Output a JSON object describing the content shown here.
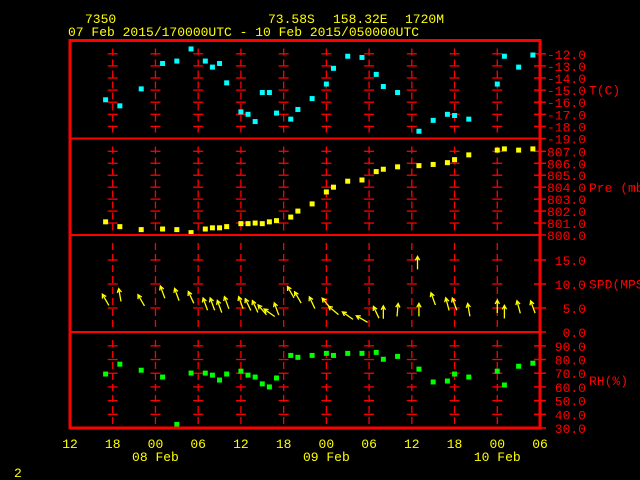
{
  "header": {
    "station_id": "7350",
    "latitude": "73.58S",
    "longitude": "158.32E",
    "elevation": "1720M",
    "time_range": "07 Feb 2015/170000UTC - 10 Feb 2015/050000UTC"
  },
  "page_number": "2",
  "colors": {
    "frame": "#ff0000",
    "text": "#ffff00",
    "temperature": "#00ffff",
    "pressure": "#ffff00",
    "wind": "#ffff00",
    "humidity": "#00ff00"
  },
  "chart_data": {
    "type": "scatter",
    "title": "7350  73.58S 158.32E 1720M  07 Feb 2015/170000UTC - 10 Feb 2015/050000UTC",
    "x_units": "hours since 07 Feb 12 UTC",
    "xlim": [
      0,
      66
    ],
    "x_ticks": [
      {
        "h": 0,
        "label": "12"
      },
      {
        "h": 6,
        "label": "18"
      },
      {
        "h": 12,
        "label": "00"
      },
      {
        "h": 18,
        "label": "06"
      },
      {
        "h": 24,
        "label": "12"
      },
      {
        "h": 30,
        "label": "18"
      },
      {
        "h": 36,
        "label": "00"
      },
      {
        "h": 42,
        "label": "06"
      },
      {
        "h": 48,
        "label": "12"
      },
      {
        "h": 54,
        "label": "18"
      },
      {
        "h": 60,
        "label": "00"
      },
      {
        "h": 66,
        "label": "06"
      }
    ],
    "date_labels": [
      {
        "h": 12,
        "label": "08 Feb"
      },
      {
        "h": 36,
        "label": "09 Feb"
      },
      {
        "h": 60,
        "label": "10 Feb"
      }
    ],
    "panels": [
      {
        "id": "temperature",
        "label": "T(C)",
        "ylim": [
          -19,
          -10.9
        ],
        "ticks": [
          {
            "v": -12,
            "label": "-12.0"
          },
          {
            "v": -13,
            "label": "-13.0"
          },
          {
            "v": -14,
            "label": "-14.0"
          },
          {
            "v": -15,
            "label": "-15.0"
          },
          {
            "v": -16,
            "label": "-16.0"
          },
          {
            "v": -17,
            "label": "-17.0"
          },
          {
            "v": -18,
            "label": "-18.0"
          },
          {
            "v": -19,
            "label": "-19.0"
          }
        ],
        "cross_levels": [
          -12,
          -13,
          -14,
          -15,
          -16,
          -17,
          -18
        ],
        "points": [
          [
            5,
            -15.8
          ],
          [
            7,
            -16.3
          ],
          [
            10,
            -14.9
          ],
          [
            13,
            -12.8
          ],
          [
            15,
            -12.6
          ],
          [
            17,
            -11.6
          ],
          [
            19,
            -12.6
          ],
          [
            20,
            -13.1
          ],
          [
            21,
            -12.8
          ],
          [
            22,
            -14.4
          ],
          [
            24,
            -16.8
          ],
          [
            25,
            -17.0
          ],
          [
            26,
            -17.6
          ],
          [
            27,
            -15.2
          ],
          [
            28,
            -15.2
          ],
          [
            29,
            -16.9
          ],
          [
            31,
            -17.4
          ],
          [
            32,
            -16.6
          ],
          [
            34,
            -15.7
          ],
          [
            36,
            -14.5
          ],
          [
            37,
            -13.2
          ],
          [
            39,
            -12.2
          ],
          [
            41,
            -12.3
          ],
          [
            43,
            -13.7
          ],
          [
            44,
            -14.7
          ],
          [
            46,
            -15.2
          ],
          [
            49,
            -18.4
          ],
          [
            51,
            -17.5
          ],
          [
            53,
            -17.0
          ],
          [
            54,
            -17.1
          ],
          [
            56,
            -17.4
          ],
          [
            60,
            -14.5
          ],
          [
            61,
            -12.2
          ],
          [
            63,
            -13.1
          ],
          [
            65,
            -12.1
          ]
        ]
      },
      {
        "id": "pressure",
        "label": "Pre (mb)",
        "ylim": [
          800,
          808.07
        ],
        "ticks": [
          {
            "v": 807,
            "label": "807.0"
          },
          {
            "v": 806,
            "label": "806.0"
          },
          {
            "v": 805,
            "label": "805.0"
          },
          {
            "v": 804,
            "label": "804.0"
          },
          {
            "v": 803,
            "label": "803.0"
          },
          {
            "v": 802,
            "label": "802.0"
          },
          {
            "v": 801,
            "label": "801.0"
          },
          {
            "v": 800,
            "label": "800.0"
          }
        ],
        "cross_levels": [
          807,
          806,
          805,
          804,
          803,
          802,
          801
        ],
        "points": [
          [
            5,
            801.1
          ],
          [
            7,
            800.7
          ],
          [
            10,
            800.45
          ],
          [
            13,
            800.5
          ],
          [
            15,
            800.45
          ],
          [
            17,
            800.2
          ],
          [
            19,
            800.5
          ],
          [
            20,
            800.6
          ],
          [
            21,
            800.6
          ],
          [
            22,
            800.7
          ],
          [
            24,
            800.95
          ],
          [
            25,
            800.95
          ],
          [
            26,
            801.0
          ],
          [
            27,
            800.95
          ],
          [
            28,
            801.1
          ],
          [
            29,
            801.2
          ],
          [
            31,
            801.5
          ],
          [
            32,
            802.0
          ],
          [
            34,
            802.6
          ],
          [
            36,
            803.6
          ],
          [
            37,
            804.0
          ],
          [
            39,
            804.5
          ],
          [
            41,
            804.6
          ],
          [
            43,
            805.3
          ],
          [
            44,
            805.5
          ],
          [
            46,
            805.7
          ],
          [
            49,
            805.8
          ],
          [
            51,
            805.9
          ],
          [
            53,
            806.05
          ],
          [
            54,
            806.3
          ],
          [
            56,
            806.7
          ],
          [
            60,
            807.1
          ],
          [
            61,
            807.2
          ],
          [
            63,
            807.1
          ],
          [
            65,
            807.2
          ]
        ]
      },
      {
        "id": "wind",
        "label": "SPD(MPS)",
        "ylim": [
          0,
          20.2
        ],
        "ticks": [
          {
            "v": 15,
            "label": "15.0"
          },
          {
            "v": 10,
            "label": "10.0"
          },
          {
            "v": 5,
            "label": "5.0"
          },
          {
            "v": 0,
            "label": "0.0"
          }
        ],
        "cross_levels": [
          15,
          10,
          5
        ],
        "arrows_note": "each arrow: [hour, speed m/s, arrow heading deg clockwise from up]",
        "arrows": [
          [
            5,
            6.7,
            330
          ],
          [
            7,
            7.7,
            350
          ],
          [
            10,
            6.6,
            330
          ],
          [
            13,
            8.3,
            340
          ],
          [
            15,
            7.8,
            340
          ],
          [
            17,
            7.2,
            335
          ],
          [
            19,
            5.8,
            340
          ],
          [
            20,
            5.8,
            340
          ],
          [
            21,
            5.3,
            340
          ],
          [
            22,
            6.1,
            340
          ],
          [
            24,
            6.1,
            340
          ],
          [
            25,
            5.7,
            335
          ],
          [
            26,
            5.3,
            335
          ],
          [
            27,
            4.6,
            320
          ],
          [
            28,
            4.0,
            305
          ],
          [
            29,
            4.8,
            340
          ],
          [
            31,
            8.3,
            330
          ],
          [
            32,
            7.2,
            330
          ],
          [
            34,
            6.1,
            335
          ],
          [
            36,
            6.0,
            320
          ],
          [
            37,
            4.5,
            310
          ],
          [
            39,
            3.4,
            305
          ],
          [
            41,
            2.7,
            300
          ],
          [
            43,
            4.1,
            335
          ],
          [
            44,
            4.1,
            0
          ],
          [
            46,
            4.6,
            5
          ],
          [
            48.8,
            14.4,
            0
          ],
          [
            49,
            4.6,
            0
          ],
          [
            51,
            6.9,
            340
          ],
          [
            53,
            5.8,
            345
          ],
          [
            54,
            5.8,
            340
          ],
          [
            56,
            4.6,
            350
          ],
          [
            60,
            5.3,
            0
          ],
          [
            61,
            4.2,
            0
          ],
          [
            63,
            5.2,
            345
          ],
          [
            65,
            5.2,
            340
          ]
        ]
      },
      {
        "id": "humidity",
        "label": "RH(%)",
        "ylim": [
          30,
          100.1
        ],
        "ticks": [
          {
            "v": 90,
            "label": "90.0"
          },
          {
            "v": 80,
            "label": "80.0"
          },
          {
            "v": 70,
            "label": "70.0"
          },
          {
            "v": 60,
            "label": "60.0"
          },
          {
            "v": 50,
            "label": "50.0"
          },
          {
            "v": 40,
            "label": "40.0"
          },
          {
            "v": 30,
            "label": "30.0"
          }
        ],
        "cross_levels": [
          90,
          80,
          70,
          60,
          50,
          40
        ],
        "points": [
          [
            5,
            69.4
          ],
          [
            7,
            76.6
          ],
          [
            10,
            72.2
          ],
          [
            13,
            67.2
          ],
          [
            15,
            32.6
          ],
          [
            17,
            70.1
          ],
          [
            19,
            70.1
          ],
          [
            20,
            68.6
          ],
          [
            21,
            65.0
          ],
          [
            22,
            69.4
          ],
          [
            24,
            71.5
          ],
          [
            25,
            68.6
          ],
          [
            26,
            67.2
          ],
          [
            27,
            62.2
          ],
          [
            28,
            60.0
          ],
          [
            29,
            66.5
          ],
          [
            31,
            83.0
          ],
          [
            32,
            81.6
          ],
          [
            34,
            83.0
          ],
          [
            36,
            84.5
          ],
          [
            37,
            83.0
          ],
          [
            39,
            84.5
          ],
          [
            41,
            84.5
          ],
          [
            43,
            85.2
          ],
          [
            44,
            80.2
          ],
          [
            46,
            82.3
          ],
          [
            49,
            73.0
          ],
          [
            51,
            63.6
          ],
          [
            53,
            64.3
          ],
          [
            54,
            69.4
          ],
          [
            56,
            67.2
          ],
          [
            60,
            71.5
          ],
          [
            61,
            61.4
          ],
          [
            63,
            75.1
          ],
          [
            65,
            77.3
          ]
        ]
      }
    ]
  }
}
